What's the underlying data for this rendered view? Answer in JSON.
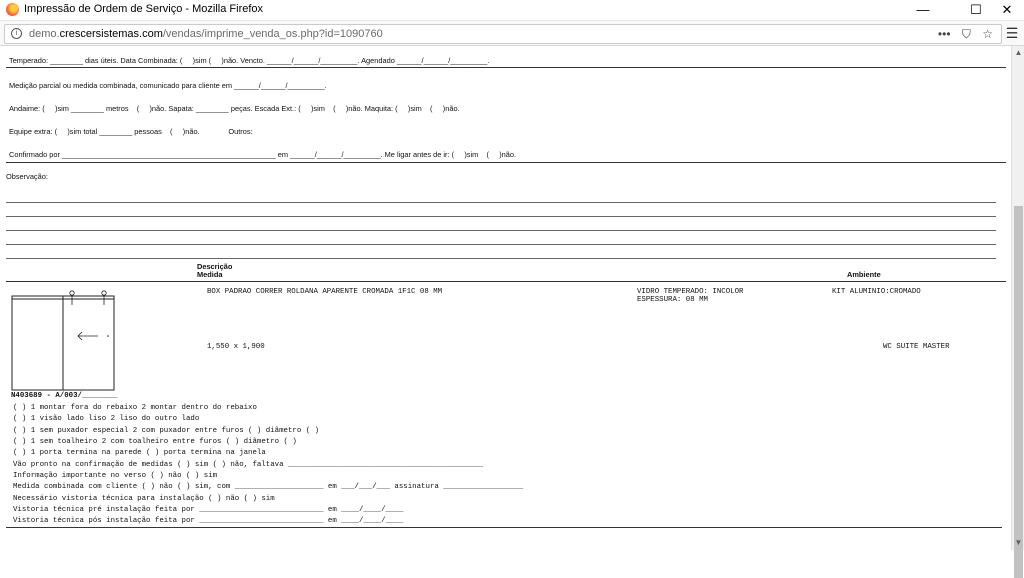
{
  "window": {
    "title": "Impressão de Ordem de Serviço - Mozilla Firefox",
    "minimize": "—",
    "maximize": "☐",
    "close": "✕"
  },
  "urlbar": {
    "url_prefix": "demo.",
    "url_domain": "crescersistemas.com",
    "url_path": "/vendas/imprime_venda_os.php?id=1090760",
    "actions": [
      "•••",
      "⛉",
      "☆"
    ],
    "menu": "☰"
  },
  "form": {
    "temperado": "Temperado: ________ dias úteis. Data Combinada: (     )sim (     )não. Vencto. ______/______/_________. Agendado ______/______/_________.",
    "medicao": "Medição parcial ou medida combinada, comunicado para cliente em ______/______/_________.",
    "andaime": "Andaime: (     )sim ________ metros    (     )não. Sapata: ________ peças. Escada Ext.: (     )sim    (     )não. Maquita: (     )sim    (     )não.",
    "equipe": "Equipe extra: (     )sim total ________ pessoas    (     )não.              Outros:",
    "confirmado": "Confirmado por ____________________________________________________ em ______/______/_________. Me ligar antes de ir: (     )sim    (     )não.",
    "observacao": "Observação:"
  },
  "table": {
    "header_descricao": "Descrição",
    "header_medida": "Medida",
    "header_ambiente": "Ambiente",
    "item": {
      "descricao": "BOX PADRAO CORRER ROLDANA APARENTE CROMADA 1F1C 08 MM",
      "vidro_1": "VIDRO TEMPERADO: INCOLOR",
      "vidro_2": "ESPESSURA: 08 MM",
      "kit": "KIT ALUMINIO:CROMADO",
      "medida": "1,550 x 1,900",
      "ambiente": "WC SUITE MASTER",
      "codigo": "N403689 - A/003/________"
    }
  },
  "checklist": [
    "( ) 1 montar fora do rebaixo 2 montar dentro do rebaixo",
    "( ) 1 visão lado liso 2 liso do outro lado",
    "( ) 1 sem puxador especial 2 com puxador entre furos ( ) diâmetro ( )",
    "( ) 1 sem toalheiro 2 com toalheiro entre furos ( ) diâmetro ( )",
    "( ) 1 porta termina na parede ( ) porta termina na janela",
    "Vão pronto na confirmação de medidas ( ) sim ( ) não, faltava ____________________________________________",
    "Informação importante no verso ( ) não ( ) sim",
    "Medida combinada com cliente ( ) não ( ) sim, com ____________________ em ___/___/___ assinatura __________________",
    "Necessário vistoria técnica para instalação ( ) não ( ) sim",
    "Vistoria técnica pré instalação feita por ____________________________ em ____/____/____",
    "Vistoria técnica pós instalação feita por ____________________________ em ____/____/____"
  ]
}
